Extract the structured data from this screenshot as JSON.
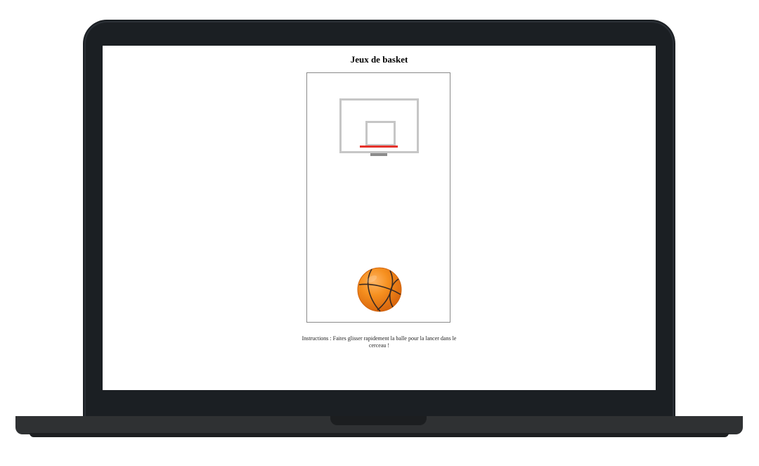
{
  "page": {
    "title": "Jeux de basket",
    "instructions": "Instructions : Faites glisser rapidement la balle pour la lancer dans le cerceau !"
  },
  "game": {
    "ball_icon": "basketball-icon",
    "colors": {
      "backboard": "#c6c6c6",
      "rim": "#e5322b",
      "ball": "#f28a1e",
      "bezel": "#1b1f23"
    }
  }
}
